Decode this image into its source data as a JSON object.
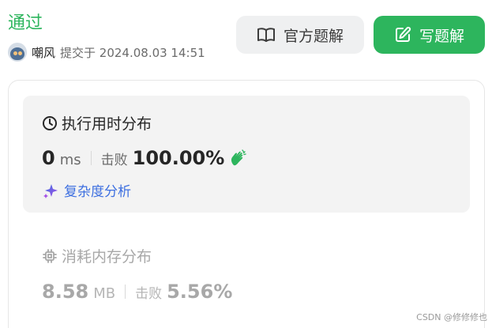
{
  "header": {
    "status": "通过",
    "username": "嘲风",
    "submitted_text": "提交于 2024.08.03 14:51",
    "official_solution_label": "官方题解",
    "write_solution_label": "写题解"
  },
  "runtime": {
    "title": "执行用时分布",
    "value": "0",
    "unit": "ms",
    "beat_label": "击败",
    "beat_pct": "100.00%",
    "complexity_label": "复杂度分析"
  },
  "memory": {
    "title": "消耗内存分布",
    "value": "8.58",
    "unit": "MB",
    "beat_label": "击败",
    "beat_pct": "5.56%"
  },
  "watermark": "CSDN @修修修也",
  "colors": {
    "accent_green": "#2db55d",
    "complexity_blue": "#3d6fe0",
    "sparkle_purple": "#a34ee6"
  },
  "icons": [
    "book-icon",
    "edit-icon",
    "clock-icon",
    "clap-icon",
    "sparkle-icon",
    "chip-icon"
  ]
}
